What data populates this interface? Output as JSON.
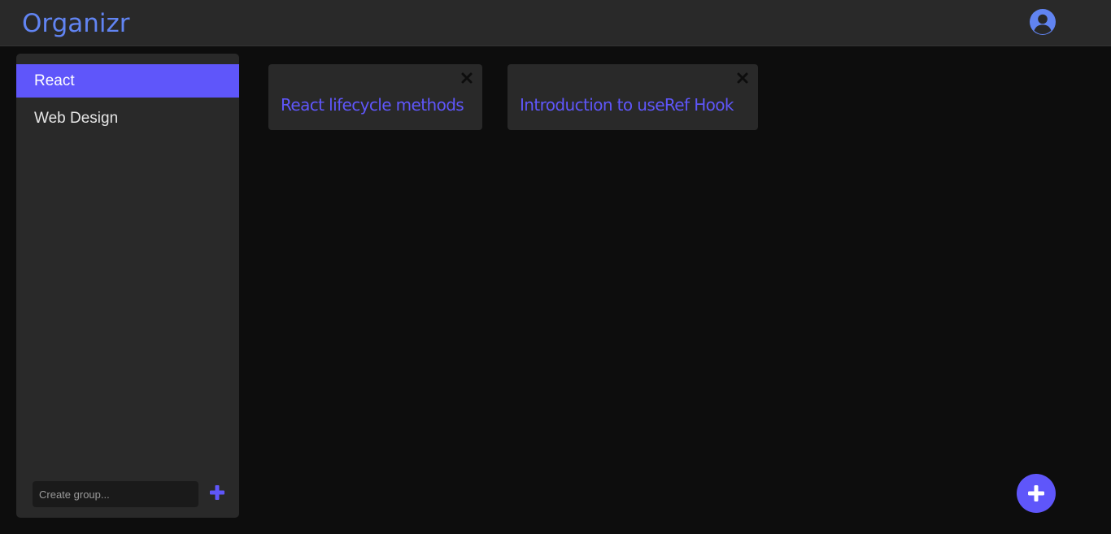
{
  "app": {
    "title": "Organizr",
    "accent_color": "#5f56fa",
    "logo_color": "#6184f2"
  },
  "header": {
    "profile_icon": "user-circle-icon"
  },
  "sidebar": {
    "groups": [
      {
        "label": "React",
        "active": true
      },
      {
        "label": "Web Design",
        "active": false
      }
    ],
    "create_group": {
      "placeholder": "Create group...",
      "value": "",
      "add_icon": "plus-icon"
    }
  },
  "main": {
    "cards": [
      {
        "title": "React lifecycle methods",
        "close_icon": "close-icon"
      },
      {
        "title": "Introduction to useRef Hook",
        "close_icon": "close-icon"
      }
    ],
    "fab_icon": "plus-icon"
  }
}
